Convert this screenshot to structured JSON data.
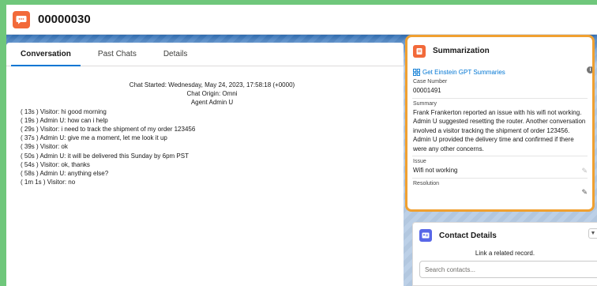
{
  "header": {
    "title": "00000030"
  },
  "tabs": [
    {
      "label": "Conversation",
      "active": true
    },
    {
      "label": "Past Chats",
      "active": false
    },
    {
      "label": "Details",
      "active": false
    }
  ],
  "chat": {
    "started": "Chat Started: Wednesday, May 24, 2023, 17:58:18 (+0000)",
    "origin": "Chat Origin: Omni",
    "agent": "Agent Admin U",
    "lines": [
      "( 13s ) Visitor: hi good morning",
      "( 19s ) Admin U: how can i help",
      "( 29s ) Visitor: i need to track the shipment of my order 123456",
      "( 37s ) Admin U: give me a moment, let me look it up",
      "( 39s ) Visitor: ok",
      "( 50s ) Admin U: it will be delivered this Sunday by 6pm PST",
      "( 54s ) Visitor: ok, thanks",
      "( 58s ) Admin U: anything else?",
      "( 1m 1s ) Visitor: no"
    ]
  },
  "summarization": {
    "title": "Summarization",
    "gpt_link": "Get Einstein GPT Summaries",
    "case_number_label": "Case Number",
    "case_number": "00001491",
    "summary_label": "Summary",
    "summary": "Frank Frankerton reported an issue with his wifi not working. Admin U suggested resetting the router. Another conversation involved a visitor tracking the shipment of order 123456. Admin U provided the delivery time and confirmed if there were any other concerns.",
    "issue_label": "Issue",
    "issue": "Wifi not working",
    "resolution_label": "Resolution",
    "resolution": ""
  },
  "contact": {
    "title": "Contact Details",
    "link_text": "Link a related record.",
    "search_placeholder": "Search contacts..."
  },
  "colors": {
    "accent_orange": "#f26a3a",
    "highlight_border": "#f0a030",
    "link_blue": "#0176d3",
    "contact_icon": "#5867e8"
  }
}
